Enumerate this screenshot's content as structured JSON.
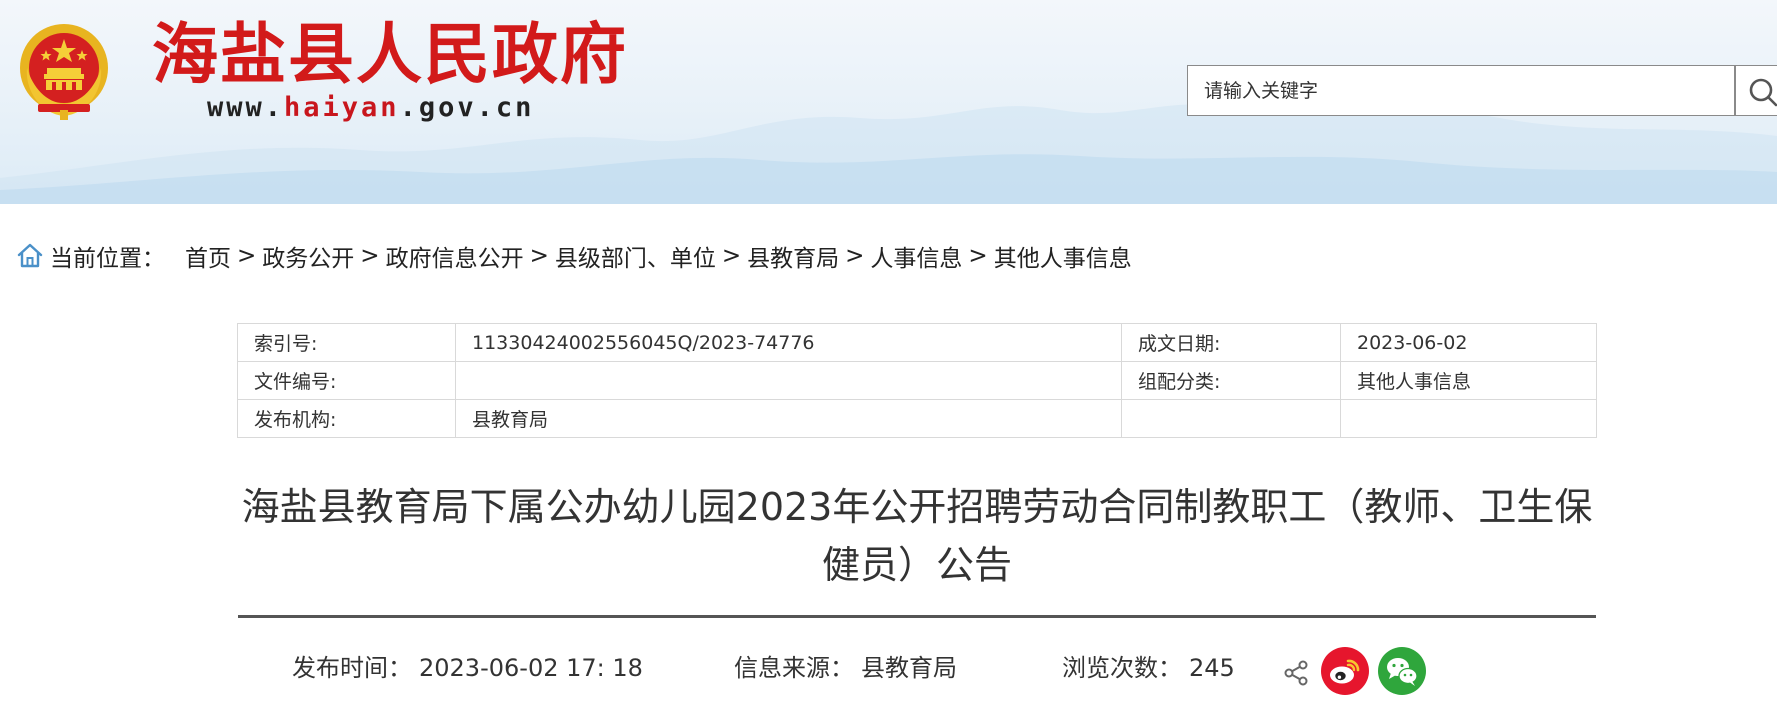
{
  "header": {
    "site_name": "海盐县人民政府",
    "url_prefix": "www.",
    "url_highlight": "haiyan",
    "url_suffix": ".gov.cn",
    "brand_color": "#d21a1a",
    "emblem_icon": "national-emblem-icon"
  },
  "search": {
    "placeholder": "请输入关键字",
    "button_icon": "search-icon"
  },
  "breadcrumb": {
    "icon": "home-icon",
    "label": "当前位置：",
    "items": [
      "首页",
      "政务公开",
      "政府信息公开",
      "县级部门、单位",
      "县教育局",
      "人事信息",
      "其他人事信息"
    ],
    "separator": ">"
  },
  "meta": {
    "index_label": "索引号:",
    "index_value": "11330424002556045Q/2023-74776",
    "date_label": "成文日期:",
    "date_value": "2023-06-02",
    "doc_no_label": "文件编号:",
    "doc_no_value": "",
    "category_label": "组配分类:",
    "category_value": "其他人事信息",
    "publisher_label": "发布机构:",
    "publisher_value": "县教育局"
  },
  "article": {
    "title": "海盐县教育局下属公办幼儿园2023年公开招聘劳动合同制教职工（教师、卫生保健员）公告"
  },
  "info": {
    "publish_time_label": "发布时间：",
    "publish_time": "2023-06-02 17: 18",
    "source_label": "信息来源：",
    "source": "县教育局",
    "views_label": "浏览次数：",
    "views": "245",
    "share_icon": "share-icon",
    "weibo_icon": "weibo-icon",
    "wechat_icon": "wechat-icon"
  }
}
